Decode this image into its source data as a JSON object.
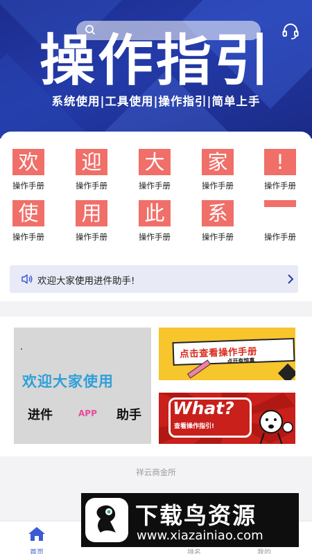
{
  "search": {
    "placeholder": ""
  },
  "hero": {
    "title": "操作指引",
    "subtitle": "系统使用|工具使用|操作指引|简单上手"
  },
  "colors": {
    "hero_bg": "#233aa8",
    "tile": "#f06f69",
    "accent": "#3b5bd6",
    "notice_bg": "#e8eaf6"
  },
  "grid": {
    "items": [
      {
        "char": "欢",
        "label": "操作手册"
      },
      {
        "char": "迎",
        "label": "操作手册"
      },
      {
        "char": "大",
        "label": "操作手册"
      },
      {
        "char": "家",
        "label": "操作手册"
      },
      {
        "char": "!",
        "label": "操作手册"
      },
      {
        "char": "使",
        "label": "操作手册"
      },
      {
        "char": "用",
        "label": "操作手册"
      },
      {
        "char": "此",
        "label": "操作手册"
      },
      {
        "char": "系",
        "label": "操作手册"
      },
      {
        "char": "",
        "label": "操作手册"
      }
    ]
  },
  "notice": {
    "text": "欢迎大家使用进件助手!",
    "icon": "speaker-icon"
  },
  "banners": {
    "main": {
      "line1": "欢迎大家使用",
      "line2": "进件",
      "line3": "APP",
      "line4": "助手"
    },
    "manual": {
      "title": "点击查看操作手册",
      "subtitle": "点开有惊喜"
    },
    "what": {
      "title": "What?",
      "subtitle": "查看操作指引!"
    }
  },
  "footer": {
    "company": "祥云商金所"
  },
  "tabbar": {
    "items": [
      {
        "label": "首页",
        "icon": "home-icon"
      },
      {
        "label": "排名",
        "icon": "rank-icon"
      },
      {
        "label": "我的",
        "icon": "user-icon"
      }
    ]
  },
  "watermark": {
    "brand": "下载鸟资源",
    "url": "www.xiazainiao.com"
  }
}
